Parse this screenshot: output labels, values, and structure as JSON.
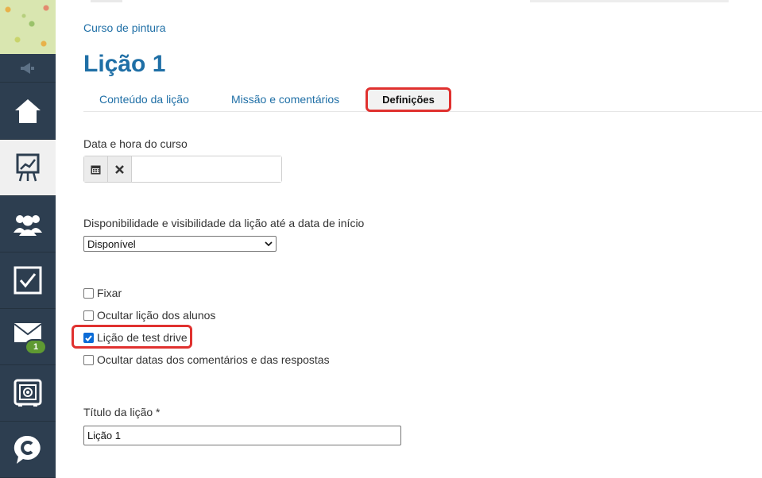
{
  "breadcrumb": "Curso de pintura",
  "page_title": "Lição 1",
  "tabs": [
    {
      "label": "Conteúdo da lição"
    },
    {
      "label": "Missão e comentários"
    },
    {
      "label": "Definições"
    }
  ],
  "sidebar": {
    "items": [
      {
        "icon": "home-icon"
      },
      {
        "icon": "presentation-chart-icon"
      },
      {
        "icon": "users-icon"
      },
      {
        "icon": "checkbox-icon"
      },
      {
        "icon": "mail-icon",
        "badge": "1"
      },
      {
        "icon": "safe-icon"
      },
      {
        "icon": "chat-c-icon"
      }
    ],
    "accent_color": "#2d3e50"
  },
  "form": {
    "date_label": "Data e hora do curso",
    "date_value": "",
    "availability_label": "Disponibilidade e visibilidade da lição até a data de início",
    "availability_selected": "Disponível",
    "checkboxes": [
      {
        "label": "Fixar",
        "checked": false
      },
      {
        "label": "Ocultar lição dos alunos",
        "checked": false
      },
      {
        "label": "Lição de test drive",
        "checked": true
      },
      {
        "label": "Ocultar datas dos comentários e das respostas",
        "checked": false
      }
    ],
    "title_label": "Título da lição *",
    "title_value": "Lição 1"
  },
  "colors": {
    "link": "#1f6fa6",
    "highlight": "#e0312f",
    "badge": "#5f9a32"
  }
}
